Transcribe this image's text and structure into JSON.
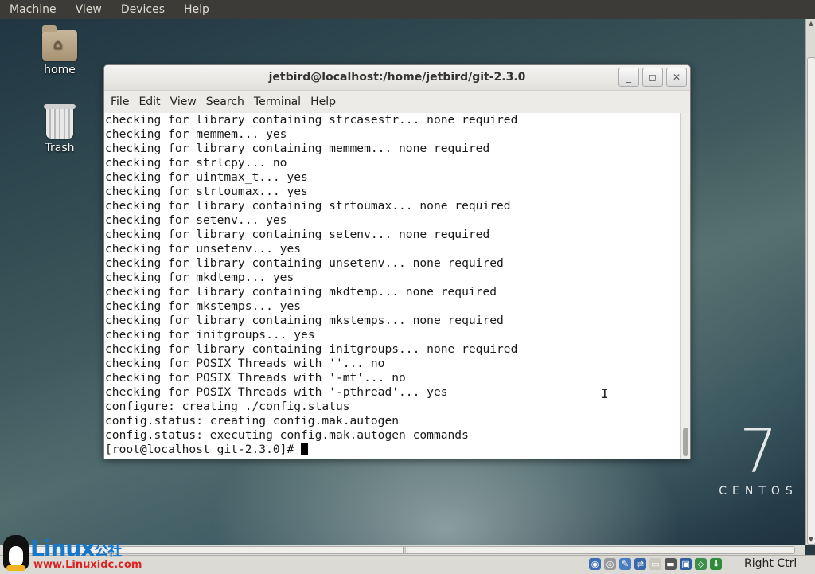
{
  "host_menu": [
    "Machine",
    "View",
    "Devices",
    "Help"
  ],
  "desktop": {
    "icons": [
      {
        "label": "home"
      },
      {
        "label": "Trash"
      }
    ],
    "logo": {
      "numeral": "7",
      "word": "CENTOS"
    }
  },
  "terminal": {
    "title": "jetbird@localhost:/home/jetbird/git-2.3.0",
    "menu": [
      "File",
      "Edit",
      "View",
      "Search",
      "Terminal",
      "Help"
    ],
    "lines": [
      "checking for library containing strcasestr... none required",
      "checking for memmem... yes",
      "checking for library containing memmem... none required",
      "checking for strlcpy... no",
      "checking for uintmax_t... yes",
      "checking for strtoumax... yes",
      "checking for library containing strtoumax... none required",
      "checking for setenv... yes",
      "checking for library containing setenv... none required",
      "checking for unsetenv... yes",
      "checking for library containing unsetenv... none required",
      "checking for mkdtemp... yes",
      "checking for library containing mkdtemp... none required",
      "checking for mkstemps... yes",
      "checking for library containing mkstemps... none required",
      "checking for initgroups... yes",
      "checking for library containing initgroups... none required",
      "checking for POSIX Threads with ''... no",
      "checking for POSIX Threads with '-mt'... no",
      "checking for POSIX Threads with '-pthread'... yes",
      "configure: creating ./config.status",
      "config.status: creating config.mak.autogen",
      "config.status: executing config.mak.autogen commands"
    ],
    "prompt": "[root@localhost git-2.3.0]# "
  },
  "status_bar": {
    "host_key": "Right Ctrl",
    "icons": [
      "harddisk-icon",
      "cdrom-icon",
      "usb-icon",
      "network-icon",
      "shared-folder-icon",
      "display-icon",
      "video-capture-icon",
      "mouse-integration-icon",
      "keyboard-icon"
    ]
  },
  "watermark": {
    "brand": "Linux",
    "brand_cn": "公社",
    "url": "www.Linuxidc.com"
  }
}
